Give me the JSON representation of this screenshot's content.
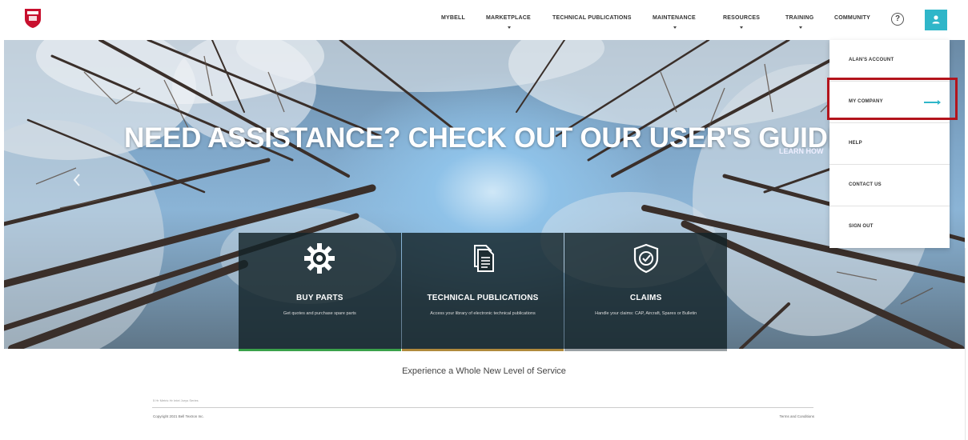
{
  "header": {
    "nav": [
      {
        "label": "MYBELL",
        "has_caret": false
      },
      {
        "label": "MARKETPLACE",
        "has_caret": true
      },
      {
        "label": "TECHNICAL PUBLICATIONS",
        "has_caret": false
      },
      {
        "label": "MAINTENANCE",
        "has_caret": true
      },
      {
        "label": "RESOURCES",
        "has_caret": true
      },
      {
        "label": "TRAINING",
        "has_caret": true
      },
      {
        "label": "COMMUNITY",
        "has_caret": false
      }
    ],
    "help_glyph": "?",
    "icons": {
      "logo": "shield-logo-icon",
      "help": "help-circle-icon",
      "user": "user-icon"
    },
    "accent_color": "#2fb6c9"
  },
  "hero": {
    "headline": "NEED ASSISTANCE? CHECK OUT OUR USER'S GUIDE",
    "learn_link": "LEARN HOW"
  },
  "cards": [
    {
      "title": "BUY PARTS",
      "desc": "Get quotes and purchase spare parts",
      "icon": "gear-icon",
      "bar_color": "#3aa14a"
    },
    {
      "title": "TECHNICAL PUBLICATIONS",
      "desc": "Access your library of electronic technical publications",
      "icon": "documents-icon",
      "bar_color": "#b08a3c"
    },
    {
      "title": "CLAIMS",
      "desc": "Handle your claims: CAP, Aircraft, Spares or Bulletin",
      "icon": "shield-check-icon",
      "bar_color": "#9aa0a4"
    }
  ],
  "dropdown": {
    "items": [
      {
        "label": "ALAN'S ACCOUNT",
        "active": false
      },
      {
        "label": "MY COMPANY",
        "active": true
      },
      {
        "label": "HELP",
        "active": false
      },
      {
        "label": "CONTACT US",
        "active": false
      },
      {
        "label": "SIGN OUT",
        "active": false
      }
    ],
    "highlight_color": "#b3141c"
  },
  "footer": {
    "tagline": "Experience a Whole New Level of Service",
    "small_text": "5 Hr Metric Hr Intel Jurys Series",
    "copyright": "Copyright 2021 Bell Textron Inc.",
    "terms": "Terms and Conditions"
  }
}
